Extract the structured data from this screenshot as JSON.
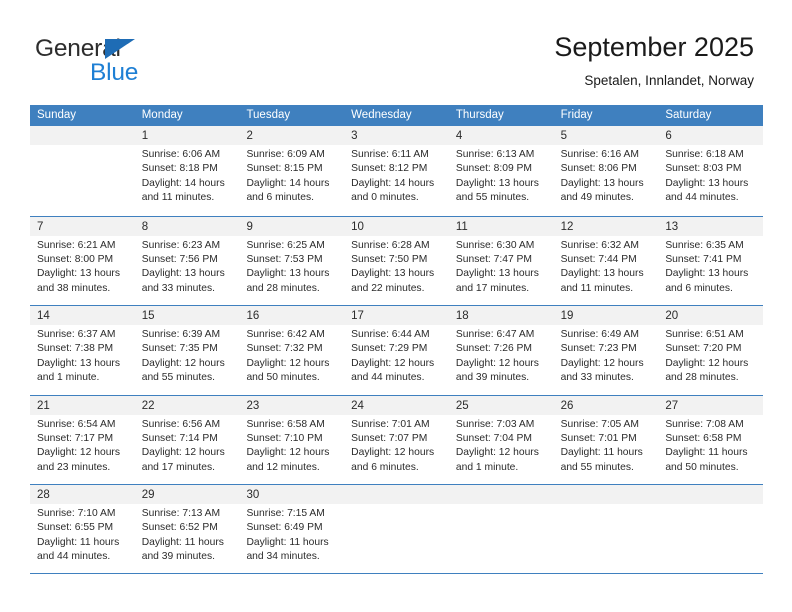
{
  "brand": {
    "name_part1": "General",
    "name_part2": "Blue",
    "triangle_color": "#1e6cb5",
    "blue_color": "#1e7fd4"
  },
  "header": {
    "title": "September 2025",
    "subtitle": "Spetalen, Innlandet, Norway"
  },
  "theme": {
    "header_blue": "#3f80bf",
    "day_band_gray": "#f2f2f2",
    "text": "#2b2b2b"
  },
  "weekdays": [
    "Sunday",
    "Monday",
    "Tuesday",
    "Wednesday",
    "Thursday",
    "Friday",
    "Saturday"
  ],
  "weeks": [
    [
      {
        "empty": true
      },
      {
        "day": "1",
        "sunrise": "Sunrise: 6:06 AM",
        "sunset": "Sunset: 8:18 PM",
        "daylight1": "Daylight: 14 hours",
        "daylight2": "and 11 minutes."
      },
      {
        "day": "2",
        "sunrise": "Sunrise: 6:09 AM",
        "sunset": "Sunset: 8:15 PM",
        "daylight1": "Daylight: 14 hours",
        "daylight2": "and 6 minutes."
      },
      {
        "day": "3",
        "sunrise": "Sunrise: 6:11 AM",
        "sunset": "Sunset: 8:12 PM",
        "daylight1": "Daylight: 14 hours",
        "daylight2": "and 0 minutes."
      },
      {
        "day": "4",
        "sunrise": "Sunrise: 6:13 AM",
        "sunset": "Sunset: 8:09 PM",
        "daylight1": "Daylight: 13 hours",
        "daylight2": "and 55 minutes."
      },
      {
        "day": "5",
        "sunrise": "Sunrise: 6:16 AM",
        "sunset": "Sunset: 8:06 PM",
        "daylight1": "Daylight: 13 hours",
        "daylight2": "and 49 minutes."
      },
      {
        "day": "6",
        "sunrise": "Sunrise: 6:18 AM",
        "sunset": "Sunset: 8:03 PM",
        "daylight1": "Daylight: 13 hours",
        "daylight2": "and 44 minutes."
      }
    ],
    [
      {
        "day": "7",
        "sunrise": "Sunrise: 6:21 AM",
        "sunset": "Sunset: 8:00 PM",
        "daylight1": "Daylight: 13 hours",
        "daylight2": "and 38 minutes."
      },
      {
        "day": "8",
        "sunrise": "Sunrise: 6:23 AM",
        "sunset": "Sunset: 7:56 PM",
        "daylight1": "Daylight: 13 hours",
        "daylight2": "and 33 minutes."
      },
      {
        "day": "9",
        "sunrise": "Sunrise: 6:25 AM",
        "sunset": "Sunset: 7:53 PM",
        "daylight1": "Daylight: 13 hours",
        "daylight2": "and 28 minutes."
      },
      {
        "day": "10",
        "sunrise": "Sunrise: 6:28 AM",
        "sunset": "Sunset: 7:50 PM",
        "daylight1": "Daylight: 13 hours",
        "daylight2": "and 22 minutes."
      },
      {
        "day": "11",
        "sunrise": "Sunrise: 6:30 AM",
        "sunset": "Sunset: 7:47 PM",
        "daylight1": "Daylight: 13 hours",
        "daylight2": "and 17 minutes."
      },
      {
        "day": "12",
        "sunrise": "Sunrise: 6:32 AM",
        "sunset": "Sunset: 7:44 PM",
        "daylight1": "Daylight: 13 hours",
        "daylight2": "and 11 minutes."
      },
      {
        "day": "13",
        "sunrise": "Sunrise: 6:35 AM",
        "sunset": "Sunset: 7:41 PM",
        "daylight1": "Daylight: 13 hours",
        "daylight2": "and 6 minutes."
      }
    ],
    [
      {
        "day": "14",
        "sunrise": "Sunrise: 6:37 AM",
        "sunset": "Sunset: 7:38 PM",
        "daylight1": "Daylight: 13 hours",
        "daylight2": "and 1 minute."
      },
      {
        "day": "15",
        "sunrise": "Sunrise: 6:39 AM",
        "sunset": "Sunset: 7:35 PM",
        "daylight1": "Daylight: 12 hours",
        "daylight2": "and 55 minutes."
      },
      {
        "day": "16",
        "sunrise": "Sunrise: 6:42 AM",
        "sunset": "Sunset: 7:32 PM",
        "daylight1": "Daylight: 12 hours",
        "daylight2": "and 50 minutes."
      },
      {
        "day": "17",
        "sunrise": "Sunrise: 6:44 AM",
        "sunset": "Sunset: 7:29 PM",
        "daylight1": "Daylight: 12 hours",
        "daylight2": "and 44 minutes."
      },
      {
        "day": "18",
        "sunrise": "Sunrise: 6:47 AM",
        "sunset": "Sunset: 7:26 PM",
        "daylight1": "Daylight: 12 hours",
        "daylight2": "and 39 minutes."
      },
      {
        "day": "19",
        "sunrise": "Sunrise: 6:49 AM",
        "sunset": "Sunset: 7:23 PM",
        "daylight1": "Daylight: 12 hours",
        "daylight2": "and 33 minutes."
      },
      {
        "day": "20",
        "sunrise": "Sunrise: 6:51 AM",
        "sunset": "Sunset: 7:20 PM",
        "daylight1": "Daylight: 12 hours",
        "daylight2": "and 28 minutes."
      }
    ],
    [
      {
        "day": "21",
        "sunrise": "Sunrise: 6:54 AM",
        "sunset": "Sunset: 7:17 PM",
        "daylight1": "Daylight: 12 hours",
        "daylight2": "and 23 minutes."
      },
      {
        "day": "22",
        "sunrise": "Sunrise: 6:56 AM",
        "sunset": "Sunset: 7:14 PM",
        "daylight1": "Daylight: 12 hours",
        "daylight2": "and 17 minutes."
      },
      {
        "day": "23",
        "sunrise": "Sunrise: 6:58 AM",
        "sunset": "Sunset: 7:10 PM",
        "daylight1": "Daylight: 12 hours",
        "daylight2": "and 12 minutes."
      },
      {
        "day": "24",
        "sunrise": "Sunrise: 7:01 AM",
        "sunset": "Sunset: 7:07 PM",
        "daylight1": "Daylight: 12 hours",
        "daylight2": "and 6 minutes."
      },
      {
        "day": "25",
        "sunrise": "Sunrise: 7:03 AM",
        "sunset": "Sunset: 7:04 PM",
        "daylight1": "Daylight: 12 hours",
        "daylight2": "and 1 minute."
      },
      {
        "day": "26",
        "sunrise": "Sunrise: 7:05 AM",
        "sunset": "Sunset: 7:01 PM",
        "daylight1": "Daylight: 11 hours",
        "daylight2": "and 55 minutes."
      },
      {
        "day": "27",
        "sunrise": "Sunrise: 7:08 AM",
        "sunset": "Sunset: 6:58 PM",
        "daylight1": "Daylight: 11 hours",
        "daylight2": "and 50 minutes."
      }
    ],
    [
      {
        "day": "28",
        "sunrise": "Sunrise: 7:10 AM",
        "sunset": "Sunset: 6:55 PM",
        "daylight1": "Daylight: 11 hours",
        "daylight2": "and 44 minutes."
      },
      {
        "day": "29",
        "sunrise": "Sunrise: 7:13 AM",
        "sunset": "Sunset: 6:52 PM",
        "daylight1": "Daylight: 11 hours",
        "daylight2": "and 39 minutes."
      },
      {
        "day": "30",
        "sunrise": "Sunrise: 7:15 AM",
        "sunset": "Sunset: 6:49 PM",
        "daylight1": "Daylight: 11 hours",
        "daylight2": "and 34 minutes."
      },
      {
        "empty": true
      },
      {
        "empty": true
      },
      {
        "empty": true
      },
      {
        "empty": true
      }
    ]
  ]
}
